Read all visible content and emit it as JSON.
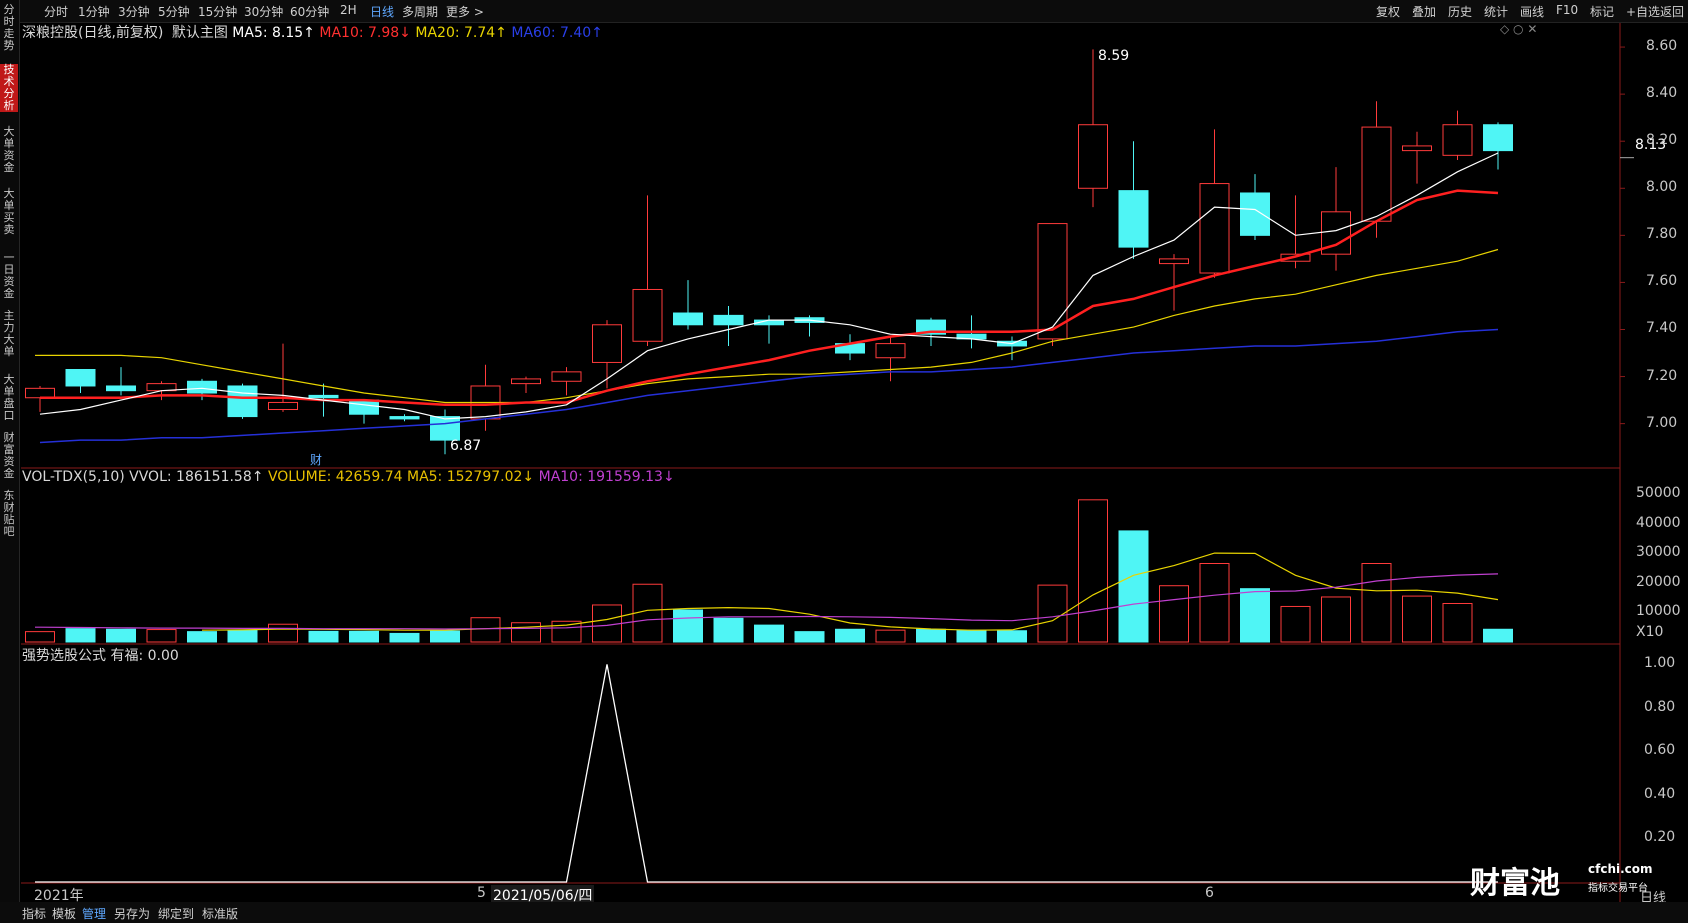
{
  "topbar": {
    "left_items": [
      "分时",
      "1分钟",
      "3分钟",
      "5分钟",
      "15分钟",
      "30分钟",
      "60分钟",
      "2H",
      "日线",
      "多周期",
      "更多 >"
    ],
    "selected": "日线",
    "right_items": [
      "复权",
      "叠加",
      "历史",
      "统计",
      "画线",
      "F10",
      "标记",
      "+自选",
      "返回"
    ]
  },
  "leftrail": {
    "items": [
      "分时走势",
      "技术分析",
      "大单资金",
      "大单买卖",
      "一日资金",
      "主力大单",
      "大单盘口",
      "财富资金",
      "东财贴吧"
    ],
    "selected": "技术分析"
  },
  "main_panel": {
    "stock": "深粮控股(日线,前复权)",
    "template": "默认主图",
    "ma5": "MA5: 8.15↑",
    "ma10": "MA10: 7.98↓",
    "ma20": "MA20: 7.74↑",
    "ma60": "MA60: 7.40↑",
    "high_label": "8.59",
    "low_label": "6.87",
    "last_price": "8.13",
    "cai_marker": "财",
    "y_ticks": [
      "8.60",
      "8.40",
      "8.20",
      "8.00",
      "7.80",
      "7.60",
      "7.40",
      "7.20",
      "7.00"
    ]
  },
  "vol_panel": {
    "title": "VOL-TDX(5,10) VVOL: 186151.58↑",
    "volume": "VOLUME: 42659.74",
    "ma5": "MA5: 152797.02↓",
    "ma10": "MA10: 191559.13↓",
    "y_ticks": [
      "50000",
      "40000",
      "30000",
      "20000",
      "10000",
      "X10"
    ]
  },
  "ind_panel": {
    "title": "强势选股公式 有福: 0.00",
    "y_ticks": [
      "1.00",
      "0.80",
      "0.60",
      "0.40",
      "0.20"
    ]
  },
  "x_axis": {
    "labels": [
      "2021年",
      "5",
      "2021/05/06/四",
      "6"
    ],
    "period_label": "日线"
  },
  "bottombar": {
    "items": [
      "指标",
      "模板",
      "管理",
      "另存为",
      "绑定到",
      "标准版"
    ],
    "selected": "管理"
  },
  "watermark": {
    "brand": "财富池",
    "site": "cfchi.com",
    "sub": "指标交易平台"
  },
  "colors": {
    "up": "#ff3b3b",
    "down": "#4ff5f5",
    "ma5": "#ffffff",
    "ma10": "#ff2020",
    "ma20": "#e8d400",
    "ma60": "#2530d8",
    "vol_ma10": "#c040d0"
  },
  "chart_data": {
    "type": "candlestick",
    "ohlc": [
      [
        7.11,
        7.16,
        7.05,
        7.15
      ],
      [
        7.23,
        7.23,
        7.13,
        7.16
      ],
      [
        7.16,
        7.24,
        7.12,
        7.14
      ],
      [
        7.14,
        7.18,
        7.1,
        7.17
      ],
      [
        7.18,
        7.19,
        7.1,
        7.13
      ],
      [
        7.16,
        7.17,
        7.02,
        7.03
      ],
      [
        7.06,
        7.34,
        7.05,
        7.09
      ],
      [
        7.12,
        7.17,
        7.03,
        7.11
      ],
      [
        7.1,
        7.1,
        7.0,
        7.04
      ],
      [
        7.03,
        7.04,
        7.01,
        7.02
      ],
      [
        7.03,
        7.06,
        6.87,
        6.93
      ],
      [
        7.02,
        7.25,
        6.97,
        7.16
      ],
      [
        7.17,
        7.2,
        7.13,
        7.19
      ],
      [
        7.18,
        7.24,
        7.12,
        7.22
      ],
      [
        7.26,
        7.44,
        7.15,
        7.42
      ],
      [
        7.35,
        7.97,
        7.33,
        7.57
      ],
      [
        7.47,
        7.61,
        7.4,
        7.42
      ],
      [
        7.46,
        7.5,
        7.33,
        7.42
      ],
      [
        7.44,
        7.46,
        7.34,
        7.42
      ],
      [
        7.45,
        7.46,
        7.37,
        7.43
      ],
      [
        7.34,
        7.38,
        7.27,
        7.3
      ],
      [
        7.28,
        7.37,
        7.18,
        7.34
      ],
      [
        7.44,
        7.45,
        7.33,
        7.38
      ],
      [
        7.38,
        7.46,
        7.32,
        7.36
      ],
      [
        7.35,
        7.37,
        7.27,
        7.33
      ],
      [
        7.36,
        7.85,
        7.33,
        7.85
      ],
      [
        8.0,
        8.59,
        7.92,
        8.27
      ],
      [
        7.99,
        8.2,
        7.7,
        7.75
      ],
      [
        7.68,
        7.72,
        7.48,
        7.7
      ],
      [
        7.64,
        8.25,
        7.62,
        8.02
      ],
      [
        7.98,
        8.06,
        7.78,
        7.8
      ],
      [
        7.69,
        7.97,
        7.66,
        7.72
      ],
      [
        7.72,
        8.09,
        7.65,
        7.9
      ],
      [
        7.86,
        8.37,
        7.79,
        8.26
      ],
      [
        8.16,
        8.24,
        8.02,
        8.18
      ],
      [
        8.14,
        8.33,
        8.12,
        8.27
      ],
      [
        8.27,
        8.28,
        8.08,
        8.16
      ]
    ],
    "ma5": [
      7.04,
      7.06,
      7.1,
      7.14,
      7.15,
      7.13,
      7.12,
      7.1,
      7.08,
      7.06,
      7.02,
      7.03,
      7.05,
      7.08,
      7.19,
      7.31,
      7.36,
      7.4,
      7.44,
      7.44,
      7.42,
      7.38,
      7.37,
      7.36,
      7.34,
      7.41,
      7.63,
      7.71,
      7.78,
      7.92,
      7.91,
      7.8,
      7.82,
      7.88,
      7.97,
      8.07,
      8.15
    ],
    "ma10": [
      7.11,
      7.11,
      7.11,
      7.12,
      7.12,
      7.11,
      7.11,
      7.1,
      7.1,
      7.09,
      7.08,
      7.08,
      7.09,
      7.09,
      7.14,
      7.18,
      7.21,
      7.24,
      7.27,
      7.31,
      7.34,
      7.37,
      7.39,
      7.39,
      7.39,
      7.4,
      7.5,
      7.53,
      7.58,
      7.63,
      7.67,
      7.71,
      7.76,
      7.86,
      7.95,
      7.99,
      7.98
    ],
    "ma20": [
      7.29,
      7.29,
      7.29,
      7.28,
      7.25,
      7.22,
      7.19,
      7.16,
      7.13,
      7.11,
      7.09,
      7.09,
      7.09,
      7.11,
      7.14,
      7.17,
      7.19,
      7.2,
      7.21,
      7.21,
      7.22,
      7.23,
      7.24,
      7.26,
      7.3,
      7.35,
      7.38,
      7.41,
      7.46,
      7.5,
      7.53,
      7.55,
      7.59,
      7.63,
      7.66,
      7.69,
      7.74
    ],
    "ma60": [
      6.92,
      6.93,
      6.93,
      6.94,
      6.94,
      6.95,
      6.96,
      6.97,
      6.98,
      6.99,
      7.0,
      7.02,
      7.04,
      7.06,
      7.09,
      7.12,
      7.14,
      7.16,
      7.18,
      7.2,
      7.21,
      7.22,
      7.22,
      7.23,
      7.24,
      7.26,
      7.28,
      7.3,
      7.31,
      7.32,
      7.33,
      7.33,
      7.34,
      7.35,
      7.37,
      7.39,
      7.4
    ],
    "volume": [
      3500,
      4500,
      4300,
      4200,
      3500,
      3900,
      6000,
      3600,
      3600,
      2900,
      3700,
      8200,
      6500,
      7000,
      12500,
      19500,
      10800,
      8000,
      5700,
      3500,
      4300,
      4000,
      4300,
      4000,
      3800,
      19200,
      48000,
      37500,
      19000,
      26500,
      18000,
      12000,
      15200,
      26500,
      15500,
      13000,
      4300
    ],
    "vol_ma5": [
      null,
      null,
      null,
      null,
      4000,
      4100,
      4400,
      4300,
      4200,
      4000,
      4000,
      4500,
      5000,
      5700,
      7600,
      10700,
      11300,
      11600,
      11300,
      9400,
      6400,
      5100,
      4400,
      4000,
      4100,
      7200,
      15900,
      22500,
      25800,
      30000,
      29900,
      22500,
      18200,
      17300,
      17500,
      16500,
      14300
    ],
    "vol_ma10": [
      5000,
      4900,
      4800,
      4700,
      4700,
      4600,
      4600,
      4500,
      4500,
      4500,
      4400,
      4500,
      4600,
      4800,
      5600,
      7500,
      8100,
      8500,
      8500,
      8600,
      8500,
      8300,
      7900,
      7400,
      7200,
      8500,
      10500,
      12800,
      14300,
      15800,
      17000,
      17200,
      18500,
      20600,
      21800,
      22600,
      23000,
      22600,
      21400,
      19200
    ],
    "ind_values": [
      0,
      0,
      0,
      0,
      0,
      0,
      0,
      0,
      0,
      0,
      0,
      0,
      0,
      0,
      1,
      0,
      0,
      0,
      0,
      0,
      0,
      0,
      0,
      0,
      0,
      0,
      0,
      0,
      0,
      0,
      0,
      0,
      0,
      0,
      0,
      0,
      0
    ],
    "price_range": [
      6.82,
      8.63
    ],
    "volume_range": [
      0,
      53000
    ],
    "ind_range": [
      0,
      1.02
    ]
  }
}
